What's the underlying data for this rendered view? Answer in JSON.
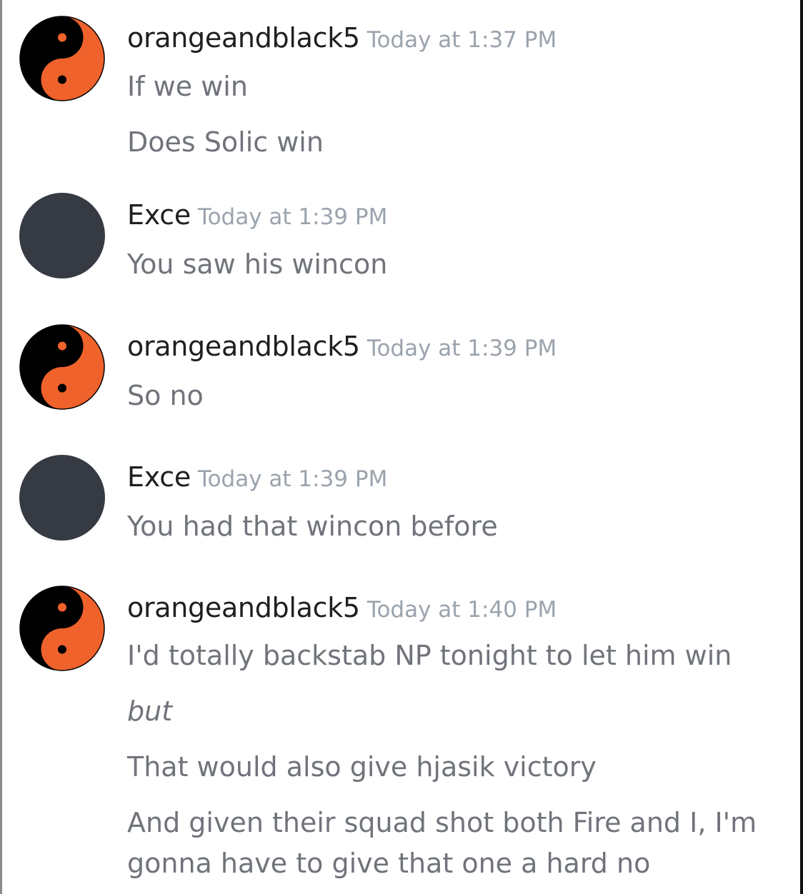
{
  "colors": {
    "avatar_orange": "#f0622c",
    "avatar_black": "#000000",
    "avatar_default": "#363a43",
    "username": "#1e1f22",
    "timestamp": "#9ba3ad",
    "message_text": "#70747a"
  },
  "messages": [
    {
      "avatar": "yin-yang-icon",
      "username": "orangeandblack5",
      "timestamp": "Today at 1:37 PM",
      "lines": [
        "If we win",
        "Does Solic win"
      ]
    },
    {
      "avatar": "default-avatar",
      "username": "Exce",
      "timestamp": "Today at 1:39 PM",
      "lines": [
        "You saw his wincon"
      ]
    },
    {
      "avatar": "yin-yang-icon",
      "username": "orangeandblack5",
      "timestamp": "Today at 1:39 PM",
      "lines": [
        "So no"
      ]
    },
    {
      "avatar": "default-avatar",
      "username": "Exce",
      "timestamp": "Today at 1:39 PM",
      "lines": [
        "You had that wincon before"
      ]
    },
    {
      "avatar": "yin-yang-icon",
      "username": "orangeandblack5",
      "timestamp": "Today at 1:40 PM",
      "lines": [
        "I'd totally backstab NP tonight to let him win",
        "but",
        "That would also give hjasik victory",
        "And given their squad shot both Fire and I, I'm",
        "gonna have to give that one a hard no"
      ]
    }
  ]
}
